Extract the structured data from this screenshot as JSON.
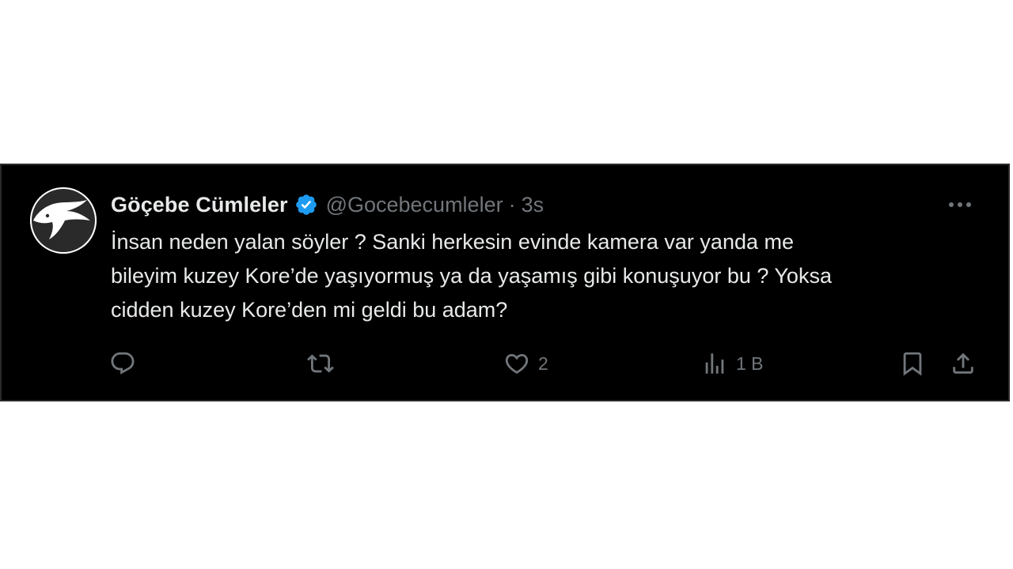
{
  "tweet": {
    "display_name": "Göçebe Cümleler",
    "handle": "@Gocebecumleler",
    "separator": "·",
    "time": "3s",
    "text_lines": [
      "İnsan neden yalan söyler ? Sanki herkesin evinde kamera var yanda me",
      "bileyim kuzey Kore’de yaşıyormuş ya da yaşamış gibi konuşuyor bu ? Yoksa",
      "cidden kuzey Kore’den mi geldi bu adam?"
    ],
    "verified_icon": "verified-badge-icon",
    "avatar_icon": "swallow-bird-logo",
    "colors": {
      "background": "#000000",
      "text": "#e7e9ea",
      "secondary": "#71767b",
      "verified": "#1d9bf0"
    }
  },
  "actions": {
    "reply": {
      "icon": "reply-icon",
      "count": ""
    },
    "retweet": {
      "icon": "retweet-icon",
      "count": ""
    },
    "like": {
      "icon": "heart-icon",
      "count": "2"
    },
    "views": {
      "icon": "views-chart-icon",
      "count": "1 B"
    },
    "bookmark": {
      "icon": "bookmark-icon"
    },
    "share": {
      "icon": "share-icon"
    }
  }
}
